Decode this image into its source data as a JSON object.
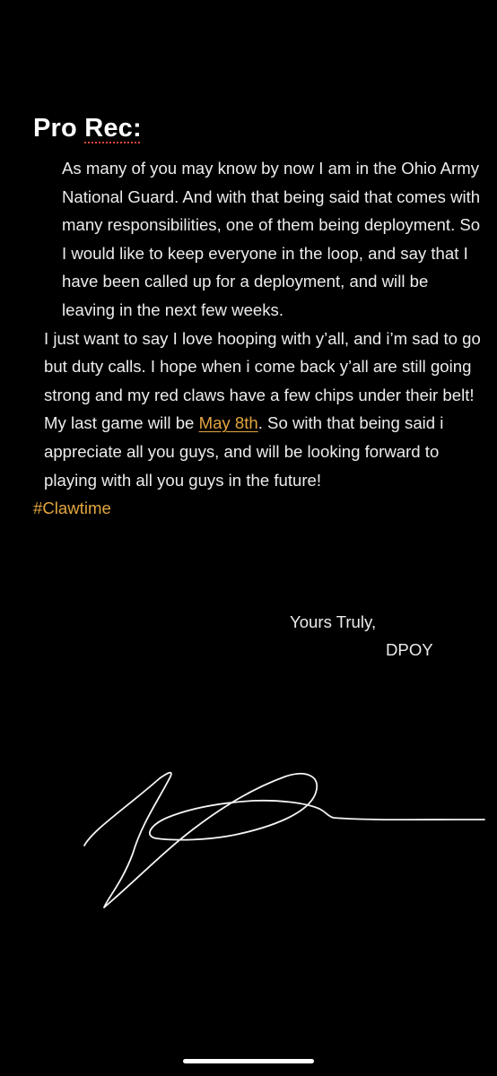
{
  "note": {
    "title_prefix": "Pro ",
    "title_word": "Rec:",
    "paragraph1": "As many of you may know by now I am in the Ohio Army National Guard. And with that being said that comes with many responsibilities, one of them being deployment. So I would like to keep everyone in the loop, and say that I have been called up for a deployment, and will be leaving in the next few weeks.",
    "paragraph2_before": "I just want to say I love hooping with y’all, and i’m sad to go but duty calls. I hope when i come back y’all are still going strong and my red claws have a few chips under their belt! My last game will be ",
    "date_link": "May 8th",
    "paragraph2_after": ". So with that being said i appreciate all you guys, and will be looking forward to playing with all you guys in the future!",
    "hashtag": "#Clawtime",
    "closing": "Yours Truly,",
    "signer": "DPOY"
  },
  "colors": {
    "background": "#000000",
    "text": "#ececec",
    "link_accent": "#e2a53f",
    "spellcheck_underline": "#e0453a"
  },
  "icons": {
    "signature": "handwritten-signature"
  }
}
